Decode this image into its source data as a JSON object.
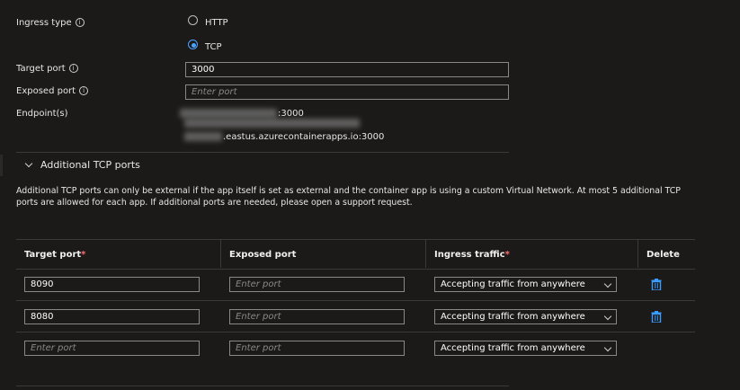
{
  "ingress": {
    "type_label": "Ingress type",
    "options": [
      "HTTP",
      "TCP"
    ],
    "selected": "TCP",
    "target_port_label": "Target port",
    "target_port_value": "3000",
    "exposed_port_label": "Exposed port",
    "exposed_port_placeholder": "Enter port",
    "endpoints_label": "Endpoint(s)",
    "endpoint1_suffix": ":3000",
    "endpoint2_suffix": ".eastus.azurecontainerapps.io:3000"
  },
  "additional": {
    "section_title": "Additional TCP ports",
    "description": "Additional TCP ports can only be external if the app itself is set as external and the container app is using a custom Virtual Network. At most 5 additional TCP ports are allowed for each app. If additional ports are needed, please open a support request.",
    "columns": {
      "target_port": "Target port",
      "exposed_port": "Exposed port",
      "ingress_traffic": "Ingress traffic",
      "delete": "Delete",
      "required_mark": "*"
    },
    "placeholder": "Enter port",
    "rows": [
      {
        "target_port": "8090",
        "traffic": "Accepting traffic from anywhere"
      },
      {
        "target_port": "8080",
        "traffic": "Accepting traffic from anywhere"
      },
      {
        "target_port": "",
        "traffic": "Accepting traffic from anywhere"
      }
    ]
  },
  "icons": {
    "info": "info-icon",
    "chevron": "chevron-down-icon",
    "delete": "trash-icon",
    "accent": "#4aa3ff"
  }
}
